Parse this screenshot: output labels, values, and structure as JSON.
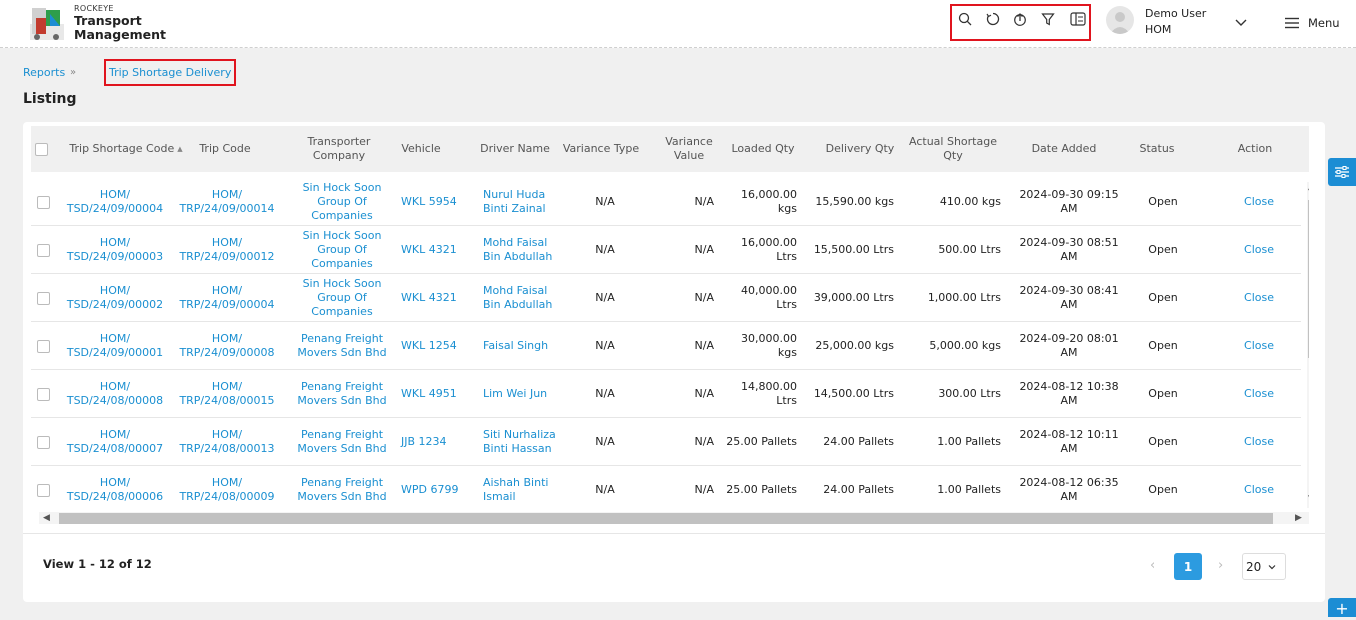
{
  "brand": {
    "company": "ROCKEYE",
    "line1": "Transport",
    "line2": "Management"
  },
  "user": {
    "name": "Demo User",
    "org": "HOM"
  },
  "menu_label": "Menu",
  "breadcrumb": {
    "root": "Reports",
    "current": "Trip Shortage Delivery"
  },
  "page_title": "Listing",
  "columns": [
    "Trip Shortage Code",
    "Trip Code",
    "Transporter Company",
    "Vehicle",
    "Driver Name",
    "Variance Type",
    "Variance Value",
    "Loaded Qty",
    "Delivery Qty",
    "Actual Shortage Qty",
    "Date Added",
    "Status",
    "Action"
  ],
  "rows": [
    [
      "HOM/ TSD/24/09/00004",
      "HOM/ TRP/24/09/00014",
      "Sin Hock Soon Group Of Companies",
      "WKL 5954",
      "Nurul Huda Binti Zainal",
      "N/A",
      "N/A",
      "16,000.00 kgs",
      "15,590.00 kgs",
      "410.00 kgs",
      "2024-09-30 09:15 AM",
      "Open",
      "Close"
    ],
    [
      "HOM/ TSD/24/09/00003",
      "HOM/ TRP/24/09/00012",
      "Sin Hock Soon Group Of Companies",
      "WKL 4321",
      "Mohd Faisal Bin Abdullah",
      "N/A",
      "N/A",
      "16,000.00 Ltrs",
      "15,500.00 Ltrs",
      "500.00 Ltrs",
      "2024-09-30 08:51 AM",
      "Open",
      "Close"
    ],
    [
      "HOM/ TSD/24/09/00002",
      "HOM/ TRP/24/09/00004",
      "Sin Hock Soon Group Of Companies",
      "WKL 4321",
      "Mohd Faisal Bin Abdullah",
      "N/A",
      "N/A",
      "40,000.00 Ltrs",
      "39,000.00 Ltrs",
      "1,000.00 Ltrs",
      "2024-09-30 08:41 AM",
      "Open",
      "Close"
    ],
    [
      "HOM/ TSD/24/09/00001",
      "HOM/ TRP/24/09/00008",
      "Penang Freight Movers Sdn Bhd",
      "WKL 1254",
      "Faisal Singh",
      "N/A",
      "N/A",
      "30,000.00 kgs",
      "25,000.00 kgs",
      "5,000.00 kgs",
      "2024-09-20 08:01 AM",
      "Open",
      "Close"
    ],
    [
      "HOM/ TSD/24/08/00008",
      "HOM/ TRP/24/08/00015",
      "Penang Freight Movers Sdn Bhd",
      "WKL 4951",
      "Lim Wei Jun",
      "N/A",
      "N/A",
      "14,800.00 Ltrs",
      "14,500.00 Ltrs",
      "300.00 Ltrs",
      "2024-08-12 10:38 AM",
      "Open",
      "Close"
    ],
    [
      "HOM/ TSD/24/08/00007",
      "HOM/ TRP/24/08/00013",
      "Penang Freight Movers Sdn Bhd",
      "JJB 1234",
      "Siti Nurhaliza Binti Hassan",
      "N/A",
      "N/A",
      "25.00 Pallets",
      "24.00 Pallets",
      "1.00 Pallets",
      "2024-08-12 10:11 AM",
      "Open",
      "Close"
    ],
    [
      "HOM/ TSD/24/08/00006",
      "HOM/ TRP/24/08/00009",
      "Penang Freight Movers Sdn Bhd",
      "WPD 6799",
      "Aishah Binti Ismail",
      "N/A",
      "N/A",
      "25.00 Pallets",
      "24.00 Pallets",
      "1.00 Pallets",
      "2024-08-12 06:35 AM",
      "Open",
      "Close"
    ]
  ],
  "pagination": {
    "view_info": "View 1 - 12 of 12",
    "current_page": "1",
    "page_size": "20"
  },
  "icons": {
    "toolbar": [
      "search-icon",
      "refresh-icon",
      "upload-icon",
      "filter-icon",
      "columns-icon"
    ]
  },
  "colors": {
    "accent": "#1a8fd1",
    "primary_button": "#2c9be0",
    "highlight_box": "#e0141e"
  }
}
